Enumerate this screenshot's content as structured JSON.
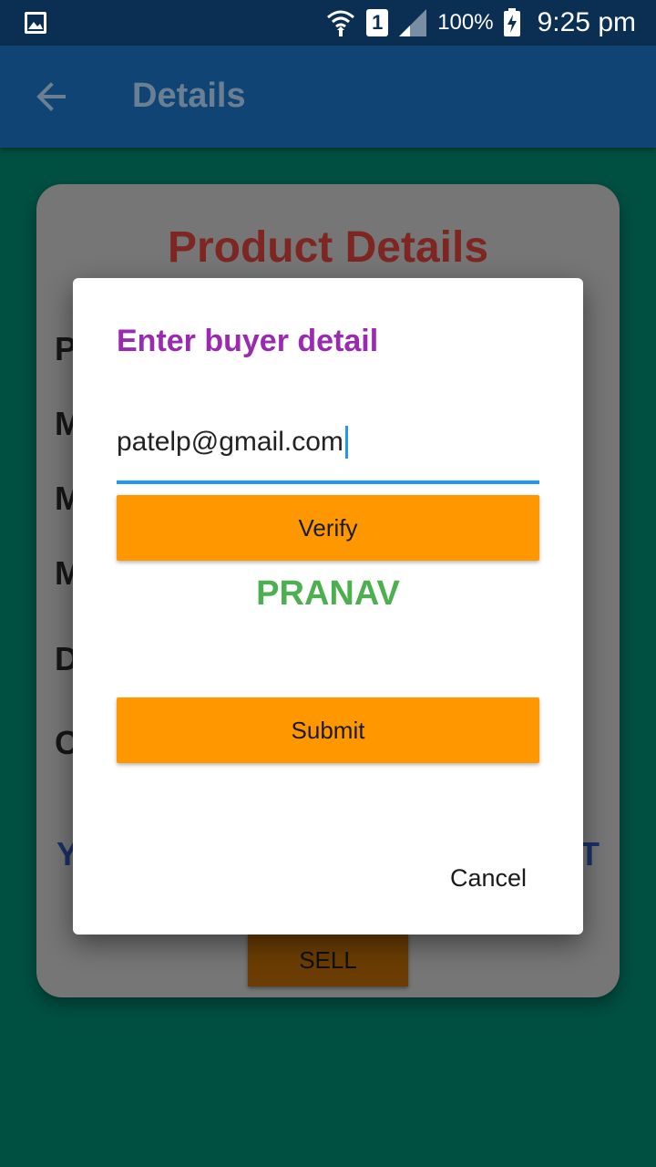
{
  "status_bar": {
    "battery_percent": "100%",
    "sim_number": "1",
    "time": "9:25 pm"
  },
  "app_bar": {
    "title": "Details"
  },
  "card": {
    "title": "Product Details",
    "row_initials": [
      "P",
      "M",
      "M",
      "M",
      "D",
      "C"
    ],
    "left_partial": "Y",
    "right_partial": "T",
    "sell_label": "SELL"
  },
  "dialog": {
    "title": "Enter buyer detail",
    "email_value": "patelp@gmail.com",
    "verify_label": "Verify",
    "buyer_name": "PRANAV",
    "submit_label": "Submit",
    "cancel_label": "Cancel"
  }
}
